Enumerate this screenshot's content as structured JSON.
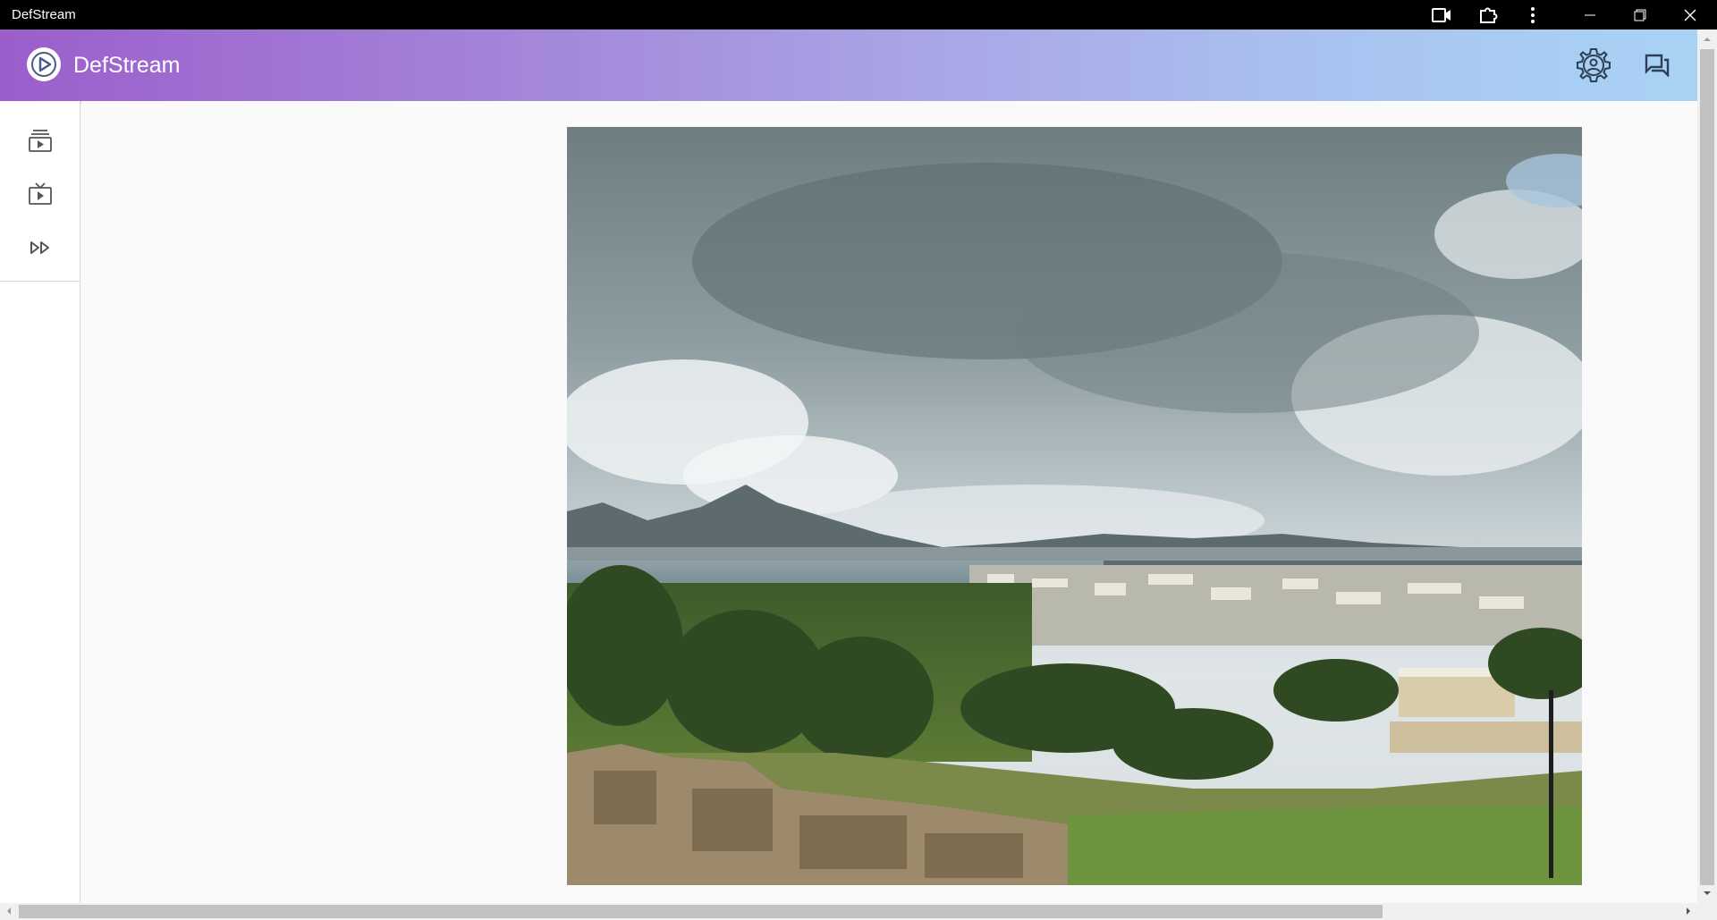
{
  "window": {
    "title": "DefStream",
    "controls": [
      "camera-icon",
      "extension-icon",
      "more-vert-icon",
      "minimize-icon",
      "restore-icon",
      "close-icon"
    ]
  },
  "header": {
    "brand": "DefStream",
    "actions": [
      "account-settings-icon",
      "chat-icon"
    ],
    "gradient": [
      "#9b5ecb",
      "#a9d3f5"
    ]
  },
  "sidebar": {
    "items": [
      {
        "icon": "playlist-icon"
      },
      {
        "icon": "live-tv-icon"
      },
      {
        "icon": "fast-forward-icon"
      }
    ]
  },
  "main": {
    "image": "landscape-photo"
  }
}
